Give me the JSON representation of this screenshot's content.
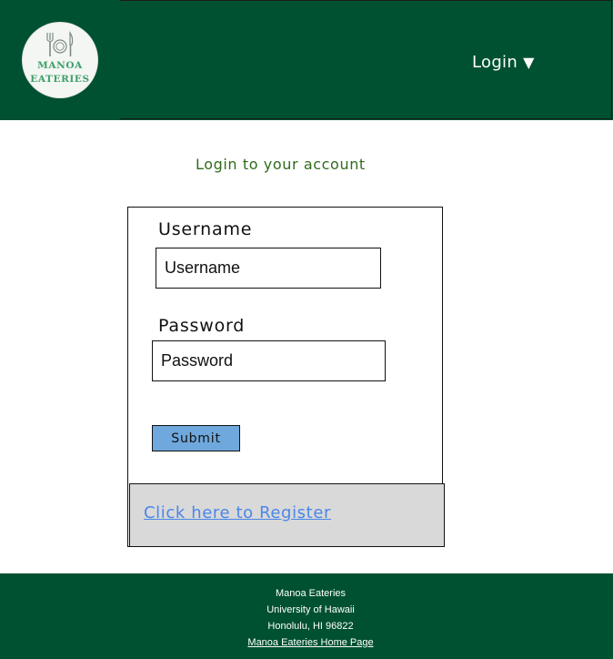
{
  "header": {
    "logo": {
      "line1": "MANOA",
      "line2": "EATERIES",
      "icon": "fork-plate-knife-icon"
    },
    "nav": {
      "login_label": "Login",
      "caret": "▼"
    }
  },
  "main": {
    "title": "Login to your account",
    "username": {
      "label": "Username",
      "placeholder": "Username"
    },
    "password": {
      "label": "Password",
      "placeholder": "Password"
    },
    "submit_label": "Submit",
    "register_link": "Click here to Register"
  },
  "footer": {
    "line1": "Manoa Eateries",
    "line2": "University of Hawaii",
    "line3": "Honolulu, HI 96822",
    "home_link": "Manoa Eateries Home Page"
  },
  "colors": {
    "brand_green": "#005131",
    "submit_blue": "#6fa8dc",
    "link_blue": "#4a86e8",
    "title_green": "#2f6b1c",
    "register_bg": "#d9d9d9"
  }
}
